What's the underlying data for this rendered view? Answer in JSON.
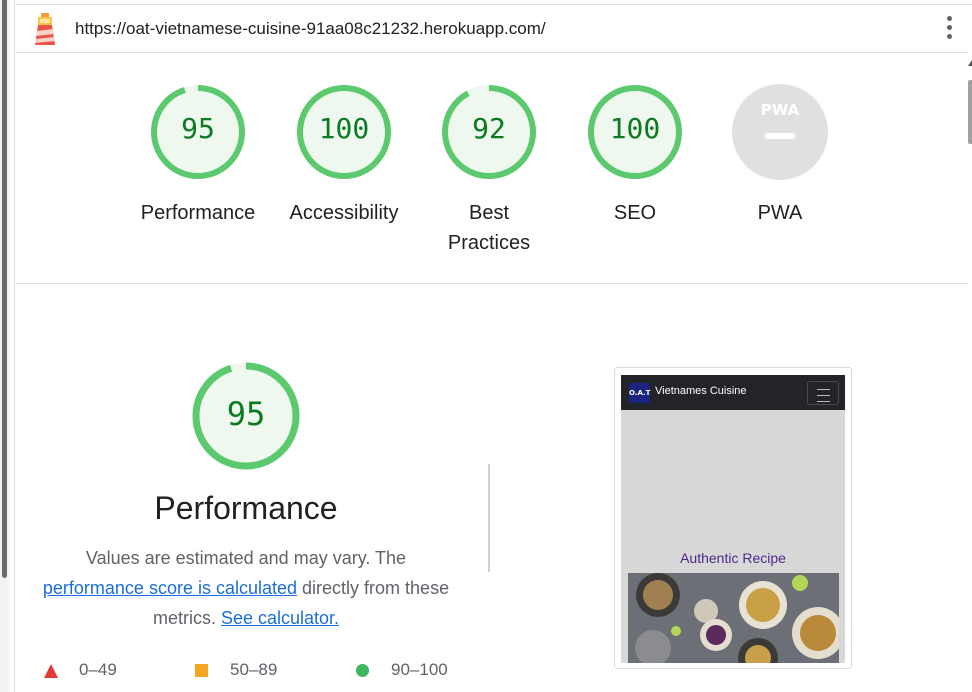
{
  "header": {
    "url": "https://oat-vietnamese-cuisine-91aa08c21232.herokuapp.com/",
    "logo_icon": "lighthouse-icon",
    "menu_icon": "kebab-menu-icon"
  },
  "categories": [
    {
      "score": "95",
      "label": "Performance",
      "value": 95
    },
    {
      "score": "100",
      "label": "Accessibility",
      "value": 100
    },
    {
      "score": "92",
      "label": "Best Practices",
      "value": 92
    },
    {
      "score": "100",
      "label": "SEO",
      "value": 100
    },
    {
      "score": "",
      "label": "PWA",
      "badge": "PWA"
    }
  ],
  "performance": {
    "score": "95",
    "title": "Performance",
    "desc_1": "Values are estimated and may vary. The",
    "link_1": "performance score is calculated",
    "desc_2": "directly from these metrics.",
    "link_2": "See calculator."
  },
  "legend": {
    "fail": "0–49",
    "average": "50–89",
    "pass": "90–100"
  },
  "screenshot": {
    "logo_text": "O.A.T",
    "brand": "Vietnames Cuisine",
    "heading": "Authentic Recipe"
  },
  "colors": {
    "pass_green": "#0c7a22",
    "ring_green": "#5cc96f",
    "ring_fill": "#eef8ef",
    "fail_red": "#e53935",
    "average_orange": "#f4a623",
    "link_blue": "#1a6ed8",
    "pwa_gray": "#e0e0e0"
  }
}
